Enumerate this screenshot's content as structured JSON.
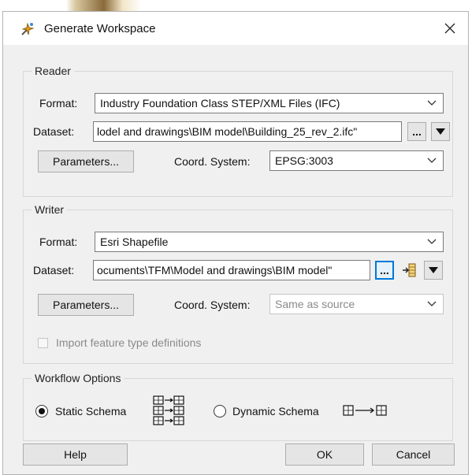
{
  "window": {
    "title": "Generate Workspace"
  },
  "reader": {
    "group_label": "Reader",
    "format_label": "Format:",
    "format_value": "Industry Foundation Class STEP/XML Files (IFC)",
    "dataset_label": "Dataset:",
    "dataset_value": "lodel and drawings\\BIM model\\Building_25_rev_2.ifc\"",
    "browse_label": "...",
    "parameters_label": "Parameters...",
    "coord_label": "Coord. System:",
    "coord_value": "EPSG:3003"
  },
  "writer": {
    "group_label": "Writer",
    "format_label": "Format:",
    "format_value": "Esri Shapefile",
    "dataset_label": "Dataset:",
    "dataset_value": "ocuments\\TFM\\Model and drawings\\BIM model\"",
    "browse_label": "...",
    "parameters_label": "Parameters...",
    "coord_label": "Coord. System:",
    "coord_value": "Same as source",
    "import_label": "Import feature type definitions"
  },
  "workflow": {
    "group_label": "Workflow Options",
    "static_label": "Static Schema",
    "dynamic_label": "Dynamic Schema",
    "selected": "Static Schema"
  },
  "footer": {
    "help_label": "Help",
    "ok_label": "OK",
    "cancel_label": "Cancel"
  },
  "colors": {
    "accent": "#0078d7",
    "dialog_bg": "#f0f0f0"
  },
  "icons": [
    "fme-app-icon",
    "close-icon",
    "chevron-down-icon",
    "dropdown-arrow-icon",
    "feature-type-icon",
    "static-schema-icon",
    "dynamic-schema-icon"
  ]
}
